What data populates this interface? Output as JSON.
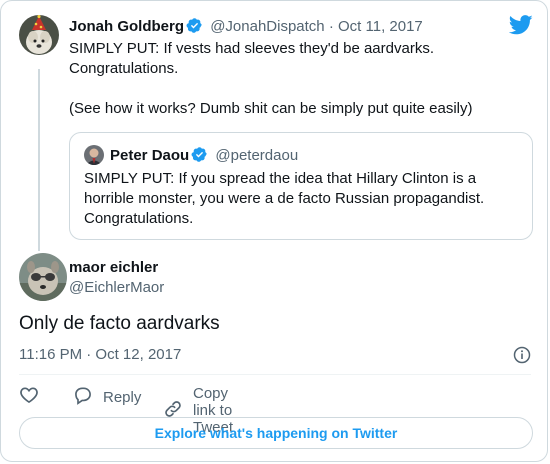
{
  "original_tweet": {
    "author_name": "Jonah Goldberg",
    "handle": "@JonahDispatch",
    "separator": "·",
    "date": "Oct 11, 2017",
    "text": "SIMPLY PUT: If vests had sleeves they'd be aardvarks.\nCongratulations.\n\n(See how it works? Dumb shit can be simply put quite easily)"
  },
  "quoted_tweet": {
    "author_name": "Peter Daou",
    "handle": "@peterdaou",
    "text": "SIMPLY PUT: If you spread the idea that Hillary Clinton is a\nhorrible monster, you were a de facto Russian propagandist.\nCongratulations."
  },
  "reply": {
    "author_name": "maor eichler",
    "handle": "@EichlerMaor",
    "text": "Only de facto aardvarks",
    "timestamp": "11:16 PM · Oct 12, 2017"
  },
  "actions": {
    "reply_label": "Reply",
    "copy_label": "Copy link to Tweet"
  },
  "explore_label": "Explore what's happening on Twitter",
  "icons": {
    "brand": "twitter-bird-icon",
    "verified": "verified-badge-icon",
    "like": "heart-icon",
    "reply": "speech-bubble-icon",
    "copy": "link-icon",
    "info": "info-icon"
  },
  "colors": {
    "accent": "#1d9bf0",
    "muted_text": "#536471",
    "border": "#cfd9de",
    "main_text": "#0f1419"
  }
}
